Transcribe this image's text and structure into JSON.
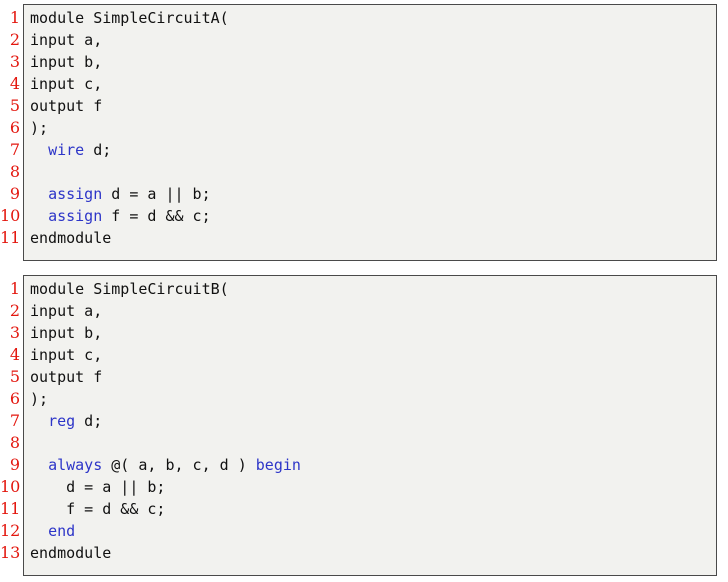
{
  "colors": {
    "line_number": "#e3170f",
    "keyword": "#2d35c8",
    "code_text": "#111111",
    "background": "#f2f2ef",
    "border": "#4a4a4a"
  },
  "listings": [
    {
      "lines": [
        {
          "number": "1",
          "segments": [
            {
              "text": "module SimpleCircuitA(",
              "kw": false
            }
          ]
        },
        {
          "number": "2",
          "segments": [
            {
              "text": "input a,",
              "kw": false
            }
          ]
        },
        {
          "number": "3",
          "segments": [
            {
              "text": "input b,",
              "kw": false
            }
          ]
        },
        {
          "number": "4",
          "segments": [
            {
              "text": "input c,",
              "kw": false
            }
          ]
        },
        {
          "number": "5",
          "segments": [
            {
              "text": "output f",
              "kw": false
            }
          ]
        },
        {
          "number": "6",
          "segments": [
            {
              "text": ");",
              "kw": false
            }
          ]
        },
        {
          "number": "7",
          "segments": [
            {
              "text": "  ",
              "kw": false
            },
            {
              "text": "wire",
              "kw": true
            },
            {
              "text": " d;",
              "kw": false
            }
          ]
        },
        {
          "number": "8",
          "segments": []
        },
        {
          "number": "9",
          "segments": [
            {
              "text": "  ",
              "kw": false
            },
            {
              "text": "assign",
              "kw": true
            },
            {
              "text": " d = a || b;",
              "kw": false
            }
          ]
        },
        {
          "number": "10",
          "segments": [
            {
              "text": "  ",
              "kw": false
            },
            {
              "text": "assign",
              "kw": true
            },
            {
              "text": " f = d && c;",
              "kw": false
            }
          ]
        },
        {
          "number": "11",
          "segments": [
            {
              "text": "endmodule",
              "kw": false
            }
          ]
        }
      ]
    },
    {
      "lines": [
        {
          "number": "1",
          "segments": [
            {
              "text": "module SimpleCircuitB(",
              "kw": false
            }
          ]
        },
        {
          "number": "2",
          "segments": [
            {
              "text": "input a,",
              "kw": false
            }
          ]
        },
        {
          "number": "3",
          "segments": [
            {
              "text": "input b,",
              "kw": false
            }
          ]
        },
        {
          "number": "4",
          "segments": [
            {
              "text": "input c,",
              "kw": false
            }
          ]
        },
        {
          "number": "5",
          "segments": [
            {
              "text": "output f",
              "kw": false
            }
          ]
        },
        {
          "number": "6",
          "segments": [
            {
              "text": ");",
              "kw": false
            }
          ]
        },
        {
          "number": "7",
          "segments": [
            {
              "text": "  ",
              "kw": false
            },
            {
              "text": "reg",
              "kw": true
            },
            {
              "text": " d;",
              "kw": false
            }
          ]
        },
        {
          "number": "8",
          "segments": []
        },
        {
          "number": "9",
          "segments": [
            {
              "text": "  ",
              "kw": false
            },
            {
              "text": "always",
              "kw": true
            },
            {
              "text": " @( a, b, c, d ) ",
              "kw": false
            },
            {
              "text": "begin",
              "kw": true
            }
          ]
        },
        {
          "number": "10",
          "segments": [
            {
              "text": "    d = a || b;",
              "kw": false
            }
          ]
        },
        {
          "number": "11",
          "segments": [
            {
              "text": "    f = d && c;",
              "kw": false
            }
          ]
        },
        {
          "number": "12",
          "segments": [
            {
              "text": "  ",
              "kw": false
            },
            {
              "text": "end",
              "kw": true
            }
          ]
        },
        {
          "number": "13",
          "segments": [
            {
              "text": "endmodule",
              "kw": false
            }
          ]
        }
      ]
    }
  ]
}
